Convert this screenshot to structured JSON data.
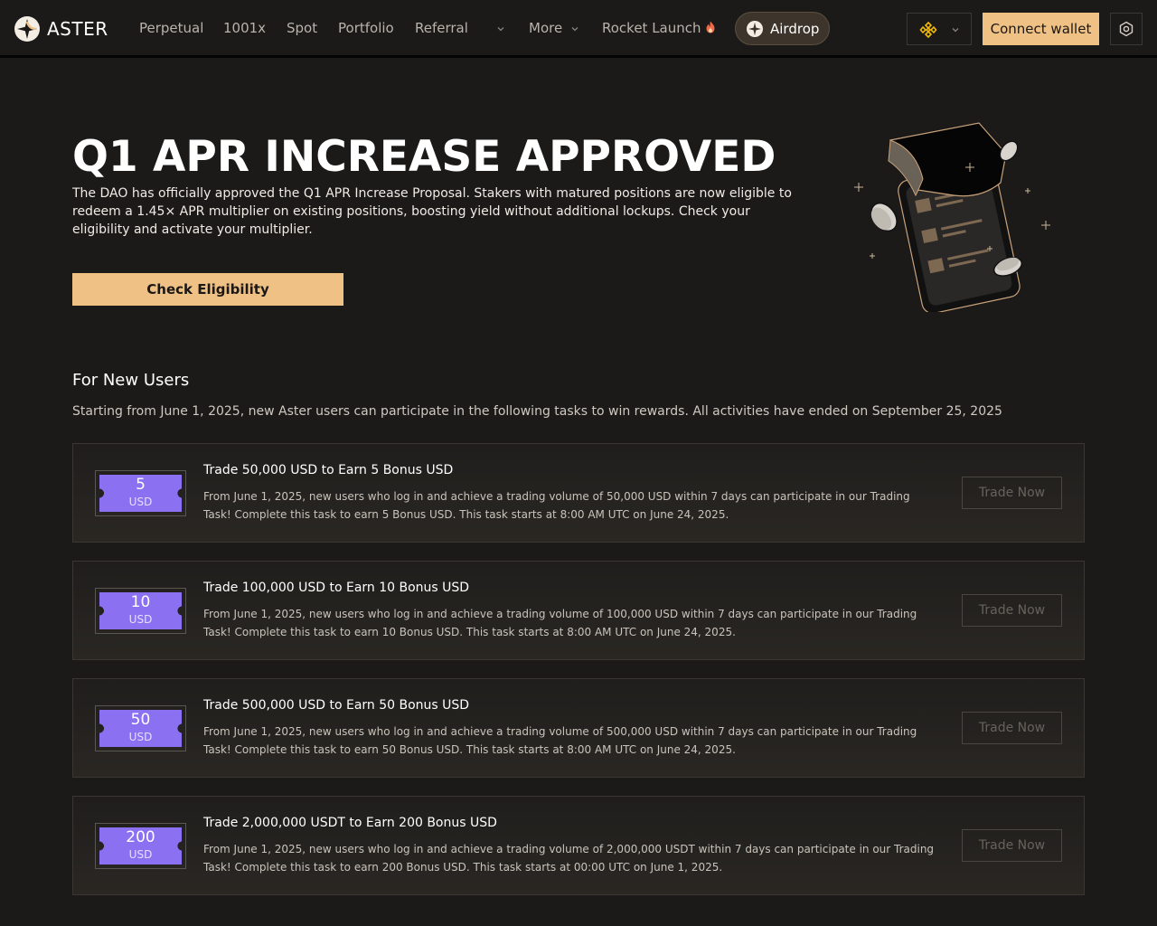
{
  "header": {
    "logo_text": "ASTER",
    "nav": [
      "Perpetual",
      "1001x",
      "Spot",
      "Portfolio",
      "Referral",
      "",
      "More",
      "Rocket Launch"
    ],
    "airdrop_label": "Airdrop",
    "connect_label": "Connect wallet",
    "icons": {
      "logo": "aster-logo-icon",
      "chain": "bnb-chain-icon",
      "settings": "settings-icon",
      "rocket": "fire-icon"
    }
  },
  "hero": {
    "title": "Q1 APR INCREASE APPROVED",
    "description": "The DAO has officially approved the Q1 APR Increase Proposal. Stakers with matured positions are now eligible to redeem a 1.45× APR multiplier on existing positions, boosting yield without additional lockups. Check your eligibility and activate your multiplier.",
    "button_label": "Check Eligibility"
  },
  "section": {
    "title": "For New Users",
    "description": "Starting from June 1, 2025, new Aster users can participate in the following tasks to win rewards. All activities have ended on September 25, 2025"
  },
  "tasks": [
    {
      "amount": "5",
      "unit": "USD",
      "title": "Trade 50,000 USD to Earn 5 Bonus USD",
      "description": "From June 1, 2025, new users who log in and achieve a trading volume of 50,000 USD within 7 days can participate in our Trading Task! Complete this task to earn 5 Bonus USD. This task starts at 8:00 AM UTC on June 24, 2025.",
      "button": "Trade Now"
    },
    {
      "amount": "10",
      "unit": "USD",
      "title": "Trade 100,000 USD to Earn 10 Bonus USD",
      "description": "From June 1, 2025, new users who log in and achieve a trading volume of 100,000 USD within 7 days can participate in our Trading Task! Complete this task to earn 10 Bonus USD. This task starts at 8:00 AM UTC on June 24, 2025.",
      "button": "Trade Now"
    },
    {
      "amount": "50",
      "unit": "USD",
      "title": "Trade 500,000 USD to Earn 50 Bonus USD",
      "description": "From June 1, 2025, new users who log in and achieve a trading volume of 500,000 USD within 7 days can participate in our Trading Task! Complete this task to earn 50 Bonus USD. This task starts at 8:00 AM UTC on June 24, 2025.",
      "button": "Trade Now"
    },
    {
      "amount": "200",
      "unit": "USD",
      "title": "Trade 2,000,000 USDT to Earn 200 Bonus USD",
      "description": "From June 1, 2025, new users who log in and achieve a trading volume of 2,000,000 USDT within 7 days can participate in our Trading Task! Complete this task to earn 200 Bonus USD. This task starts at 00:00 UTC on June 1, 2025.",
      "button": "Trade Now"
    }
  ],
  "colors": {
    "background": "#1b1a19",
    "accent": "#f0c185",
    "ticket": "#8b70f2"
  }
}
